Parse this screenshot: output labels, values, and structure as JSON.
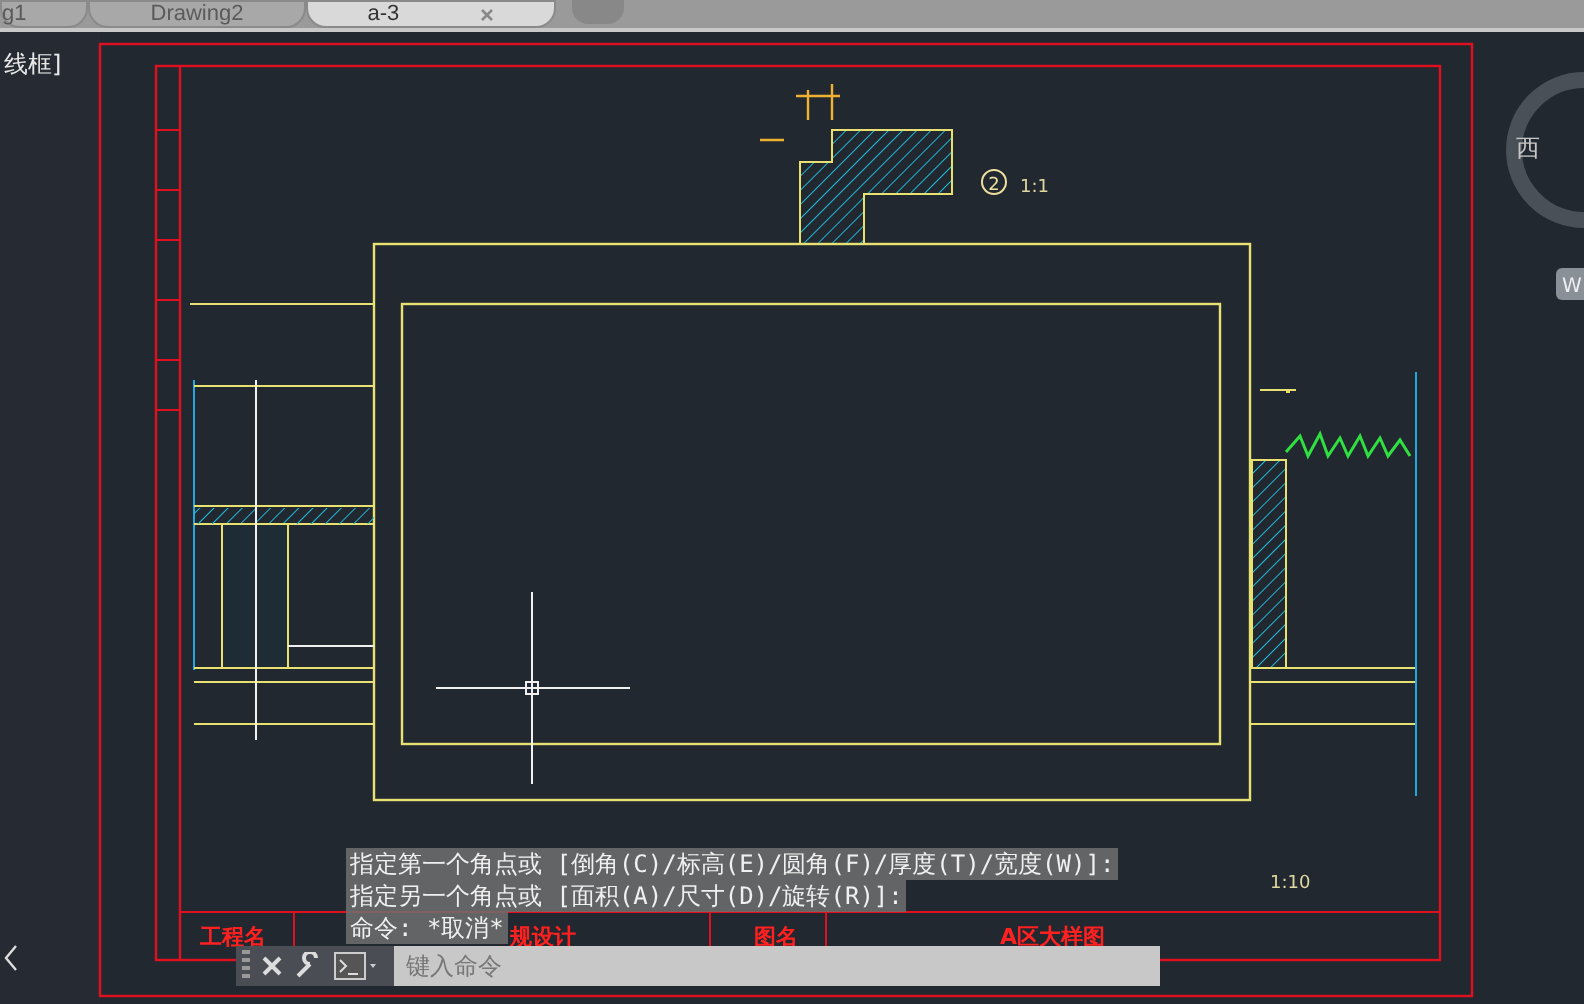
{
  "tabs": [
    {
      "label": "g1",
      "selected": false
    },
    {
      "label": "Drawing2",
      "selected": false
    },
    {
      "label": "a-3",
      "selected": true
    }
  ],
  "viewport_label": "线框]",
  "drawing": {
    "detail_marker": "2",
    "detail_scale": "1:1",
    "section_scale": "1:10",
    "title_block": [
      {
        "text": "工程名"
      },
      {
        "text": "规设计"
      },
      {
        "text": "图名"
      },
      {
        "text": "A区大样图"
      }
    ]
  },
  "compass": {
    "direction": "西",
    "badge": "W"
  },
  "command_history": [
    "指定第一个角点或 [倒角(C)/标高(E)/圆角(F)/厚度(T)/宽度(W)]:",
    "指定另一个角点或 [面积(A)/尺寸(D)/旋转(R)]:",
    "命令: *取消*"
  ],
  "command_input": {
    "placeholder": "键入命令"
  }
}
